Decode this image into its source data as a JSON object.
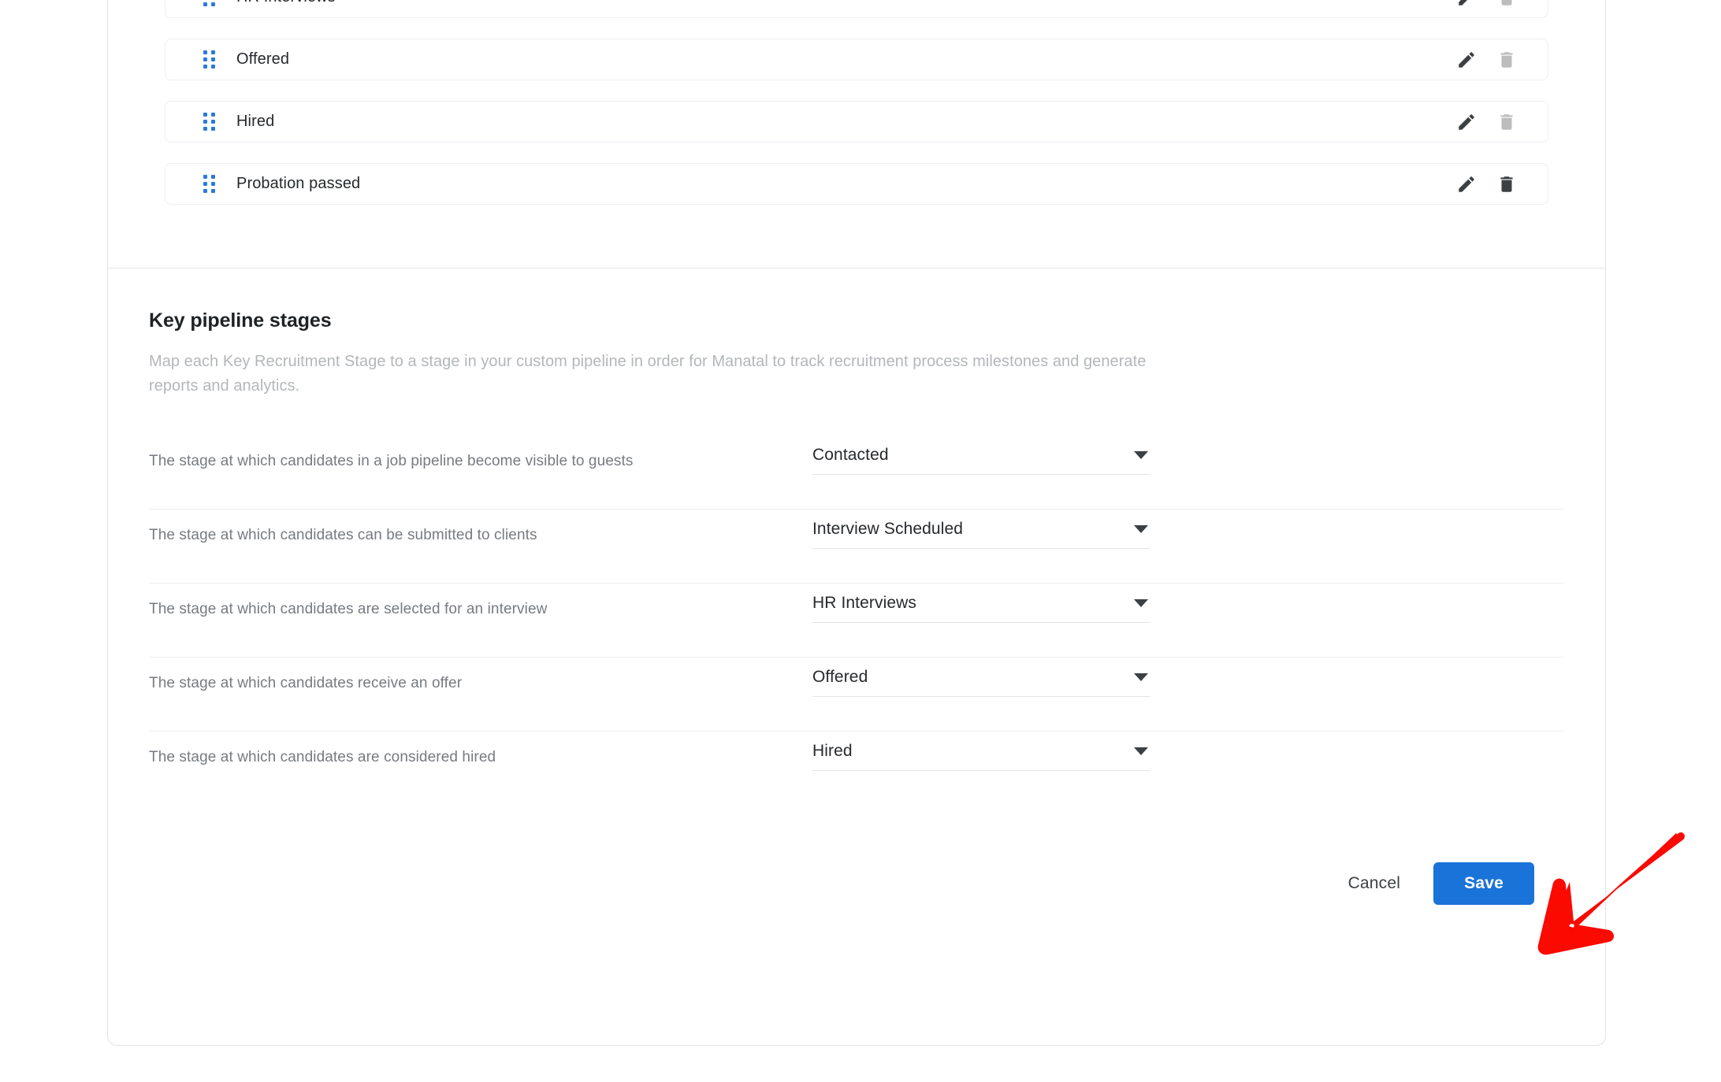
{
  "stage_list": {
    "items": [
      {
        "name": "HR Interviews",
        "drag_icon": "drag-handle-icon",
        "edit_icon": "pencil-icon",
        "delete_icon": "trash-icon",
        "delete_active": false
      },
      {
        "name": "Offered",
        "drag_icon": "drag-handle-icon",
        "edit_icon": "pencil-icon",
        "delete_icon": "trash-icon",
        "delete_active": false
      },
      {
        "name": "Hired",
        "drag_icon": "drag-handle-icon",
        "edit_icon": "pencil-icon",
        "delete_icon": "trash-icon",
        "delete_active": false
      },
      {
        "name": "Probation passed",
        "drag_icon": "drag-handle-icon",
        "edit_icon": "pencil-icon",
        "delete_icon": "trash-icon",
        "delete_active": true
      }
    ]
  },
  "section": {
    "title": "Key pipeline stages",
    "description": "Map each Key Recruitment Stage to a stage in your custom pipeline in order for Manatal to track recruitment process milestones and generate reports and analytics."
  },
  "mappings": [
    {
      "label": "The stage at which candidates in a job pipeline become visible to guests",
      "value": "Contacted",
      "caret_icon": "chevron-down-icon"
    },
    {
      "label": "The stage at which candidates can be submitted to clients",
      "value": "Interview Scheduled",
      "caret_icon": "chevron-down-icon"
    },
    {
      "label": "The stage at which candidates are selected for an interview",
      "value": "HR Interviews",
      "caret_icon": "chevron-down-icon"
    },
    {
      "label": "The stage at which candidates receive an offer",
      "value": "Offered",
      "caret_icon": "chevron-down-icon"
    },
    {
      "label": "The stage at which candidates are considered hired",
      "value": "Hired",
      "caret_icon": "chevron-down-icon"
    }
  ],
  "footer": {
    "cancel_label": "Cancel",
    "save_label": "Save"
  },
  "annotation": {
    "arrow_icon": "red-arrow-pointing-to-save",
    "color": "#fa0a01"
  },
  "colors": {
    "accent_blue": "#1a73d9",
    "drag_dot_blue": "#2a7ade",
    "label_gray": "#777b80",
    "desc_gray": "#b4b7ba",
    "icon_dark": "#3c4043",
    "icon_light": "#bdbdbd",
    "annotation_red": "#fa0a01"
  }
}
